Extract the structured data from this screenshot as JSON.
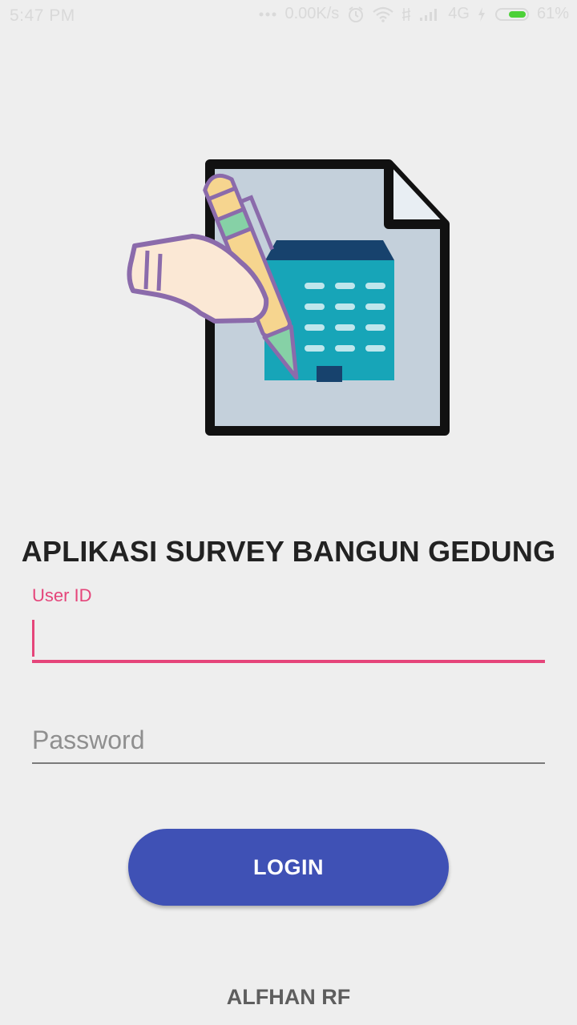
{
  "status_bar": {
    "time": "5:47 PM",
    "network_speed": "0.00K/s",
    "network_type": "4G",
    "battery": "61%",
    "battery_level": 0.61,
    "battery_color": "#4cd137",
    "icons": [
      "dots-icon",
      "alarm-icon",
      "wifi-icon",
      "sim-icon",
      "signal-icon",
      "charging-icon",
      "battery-icon"
    ]
  },
  "logo": {
    "icon": "survey-document-pen-icon"
  },
  "app_title": "APLIKASI SURVEY BANGUN GEDUNG",
  "form": {
    "user_id": {
      "label": "User ID",
      "value": "",
      "accent_color": "#e5457a"
    },
    "password": {
      "placeholder": "Password",
      "value": ""
    },
    "login_label": "LOGIN",
    "button_color": "#3f51b5"
  },
  "footer": "ALFHAN RF"
}
